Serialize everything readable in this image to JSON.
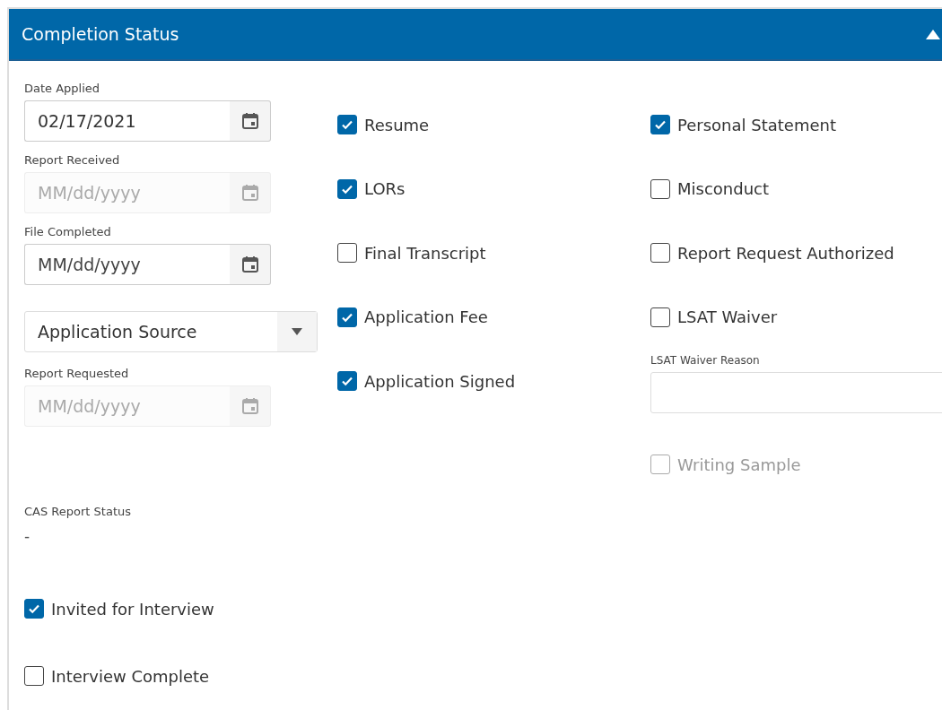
{
  "panel": {
    "title": "Completion Status",
    "expanded": true
  },
  "left_fields": [
    {
      "kind": "date",
      "label": "Date Applied",
      "value": "02/17/2021",
      "disabled": false
    },
    {
      "kind": "date",
      "label": "Report Received",
      "placeholder": "MM/dd/yyyy",
      "disabled": true
    },
    {
      "kind": "date",
      "label": "File Completed",
      "placeholder": "MM/dd/yyyy",
      "disabled": false
    },
    {
      "kind": "select",
      "value": "Application Source",
      "disabled": false
    },
    {
      "kind": "date",
      "label": "Report Requested",
      "placeholder": "MM/dd/yyyy",
      "disabled": true
    }
  ],
  "cas_report_status": {
    "label": "CAS Report Status",
    "value": "-"
  },
  "interview_checks": [
    {
      "label": "Invited for Interview",
      "checked": true,
      "disabled": false
    },
    {
      "label": "Interview Complete",
      "checked": false,
      "disabled": false
    }
  ],
  "middle_checks": [
    {
      "label": "Resume",
      "checked": true,
      "disabled": false
    },
    {
      "label": "LORs",
      "checked": true,
      "disabled": false
    },
    {
      "label": "Final Transcript",
      "checked": false,
      "disabled": false
    },
    {
      "label": "Application Fee",
      "checked": true,
      "disabled": false
    },
    {
      "label": "Application Signed",
      "checked": true,
      "disabled": false
    }
  ],
  "right_items": [
    {
      "kind": "checkbox",
      "label": "Personal Statement",
      "checked": true,
      "disabled": false
    },
    {
      "kind": "checkbox",
      "label": "Misconduct",
      "checked": false,
      "disabled": false
    },
    {
      "kind": "checkbox",
      "label": "Report Request Authorized",
      "checked": false,
      "disabled": false
    },
    {
      "kind": "checkbox",
      "label": "LSAT Waiver",
      "checked": false,
      "disabled": false
    },
    {
      "kind": "textarea",
      "label": "LSAT Waiver Reason"
    },
    {
      "kind": "checkbox",
      "label": "Writing Sample",
      "checked": false,
      "disabled": true
    }
  ]
}
